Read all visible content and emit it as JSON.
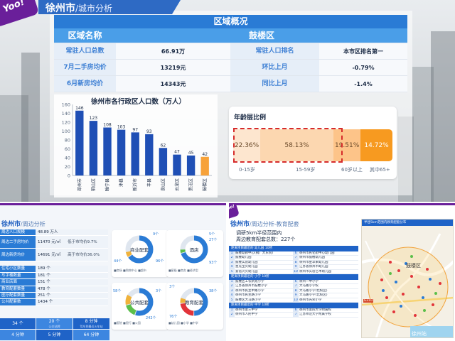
{
  "top": {
    "brand": "Yoo!",
    "title": "徐州市",
    "subtitle": "/城市分析",
    "overview": {
      "title": "区域概况",
      "header_label": "区域名称",
      "header_value": "鼓楼区",
      "rows": [
        {
          "label": "常驻人口总数",
          "value": "66.91万",
          "label2": "常驻人口排名",
          "value2": "本市区排名第一"
        },
        {
          "label": "7月二手房均价",
          "value": "13219元",
          "label2": "环比上月",
          "value2": "-0.79%"
        },
        {
          "label": "6月新房均价",
          "value": "14343元",
          "label2": "同比上月",
          "value2": "-1.4%"
        }
      ]
    },
    "age": {
      "title": "年龄层比例",
      "segments": [
        {
          "value": "22.36%",
          "label": "0-15岁"
        },
        {
          "value": "58.13%",
          "label": "15-59岁"
        },
        {
          "value": "19.51%",
          "label": "60岁以上"
        },
        {
          "value": "14.72%",
          "label": "其中65+"
        }
      ]
    }
  },
  "chart_data": {
    "type": "bar",
    "title": "徐州市各行政区人口数（万人）",
    "categories": [
      "邳州市",
      "铜山区",
      "睢宁县",
      "沛县",
      "新沂市",
      "丰县",
      "泉山区",
      "云龙区",
      "贾汪区",
      "鼓楼区"
    ],
    "values": [
      146,
      123,
      108,
      103,
      97,
      93,
      62,
      47,
      45,
      42
    ],
    "ylim": [
      0,
      160
    ],
    "yticks": [
      0,
      20,
      40,
      60,
      80,
      100,
      120,
      140,
      160
    ],
    "bar_color": "#1f4fb5",
    "highlight_color": "#f7a23a",
    "highlight_index": 9,
    "grid": false
  },
  "bottom_left": {
    "title": "徐州市",
    "subtitle": "/周边分析",
    "stats": [
      {
        "k": "周边人口规模",
        "v": "48.89 万人"
      },
      {
        "k": "周边二手房均价",
        "v": "11470 元/㎡",
        "note": "低于市均价9.7%"
      },
      {
        "k": "周边新房均价",
        "v": "14691 元/㎡",
        "note": "高于市均价36.0%"
      },
      {
        "k": "住宅小区数量",
        "v": "189 个"
      },
      {
        "k": "写字楼数量",
        "v": "181 个"
      },
      {
        "k": "商业店面",
        "v": "151 个"
      },
      {
        "k": "教育配套数量",
        "v": "478 个"
      },
      {
        "k": "医疗配套数量",
        "v": "251 个"
      },
      {
        "k": "公共配套数",
        "v": "1434 个"
      }
    ],
    "tiles": [
      {
        "n": "34 个",
        "s": ""
      },
      {
        "n": "20 个",
        "s": "公交站牌"
      },
      {
        "n": "8 分钟",
        "s": "驾车到最近火车站"
      },
      {
        "n": "4 分钟",
        "s": ""
      },
      {
        "n": "5 分钟",
        "s": ""
      },
      {
        "n": "64 分钟",
        "s": ""
      }
    ],
    "donuts": [
      {
        "label": "商业配套",
        "nums": [
          "9个",
          "44个",
          "96个"
        ],
        "legend": "■商场 ■购物中心 ■超市"
      },
      {
        "label": "酒店",
        "nums": [
          "5个",
          "27个",
          "93个"
        ],
        "legend": "■星级 ■商务 ■经济型"
      },
      {
        "label": "公共配套",
        "nums": [
          "58个",
          "3个",
          "242个"
        ],
        "legend": "■医院 ■银行 ■公园"
      },
      {
        "label": "教育配套",
        "nums": [
          "3个",
          "38个",
          "76个"
        ],
        "legend": "■幼儿园 ■小学 ■中学"
      }
    ]
  },
  "bottom_right": {
    "brand": "Yoo!",
    "title": "徐州市",
    "subtitle": "/周边分析-教育配套",
    "survey_line1": "调研5km半径范围内",
    "survey_line2": "周边教育配套总数：227个",
    "sections": [
      {
        "head": "距离项目最近的 幼儿园 10所",
        "rows": [
          [
            "1",
            "鼓楼幼教中心(钢厂大东院)",
            "6",
            "徐州市民化街中心幼儿园"
          ],
          [
            "2",
            "鼓楼幼儿园",
            "7",
            "徐州市鼓楼幼儿园"
          ],
          [
            "3",
            "鼓楼实验幼儿园",
            "8",
            "徐州市金苹果幼儿园"
          ],
          [
            "4",
            "星光宝贝幼儿园",
            "9",
            "江苏省徐州市幼儿园"
          ],
          [
            "5",
            "爱蓓贝贝幼儿园",
            "10",
            "徐州市实验艺术幼儿园"
          ]
        ]
      },
      {
        "head": "距离项目最近的 小学 10所",
        "rows": [
          [
            "1",
            "鼓楼区工农新苑小学",
            "6",
            "徐州一中小学"
          ],
          [
            "2",
            "江苏省徐州市鼓楼小学",
            "7",
            "大马路小学校"
          ],
          [
            "3",
            "徐州市民主中路小学",
            "8",
            "大马路小学(北校区)"
          ],
          [
            "4",
            "徐州市民主路小学",
            "9",
            "大马路小学(北校区)"
          ],
          [
            "5",
            "鼓楼区大马路小学",
            "10",
            "徐州市光荣小学"
          ]
        ]
      },
      {
        "head": "距离项目最近的 中学 10所",
        "rows": [
          [
            "1",
            "徐州市第三中学",
            "6",
            "徐州市第四大学附属校"
          ],
          [
            "2",
            "徐州市人民中学",
            "7",
            "江苏师范大学附属学校"
          ]
        ]
      }
    ],
    "map": {
      "head": "半径5km范围内教育配套分布",
      "label_district": "鼓楼区",
      "label_station": "徐州站",
      "label_road": "G310"
    }
  }
}
